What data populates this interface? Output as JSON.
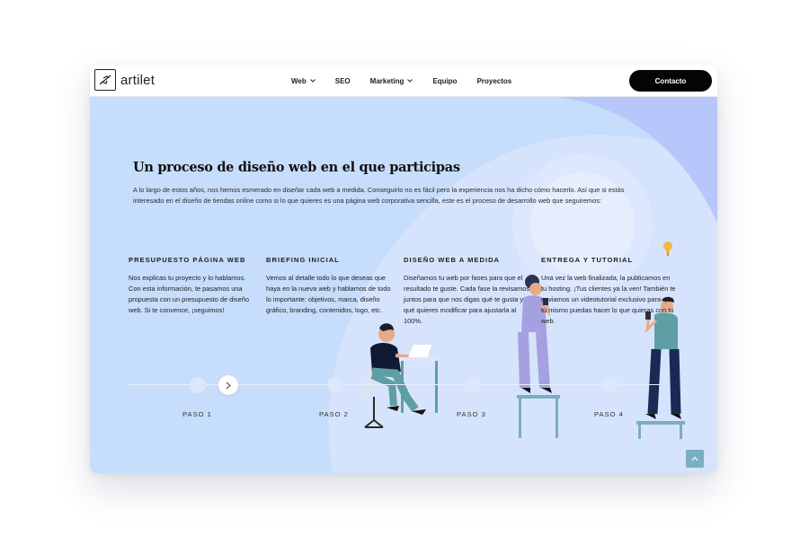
{
  "brand": {
    "name": "artilet",
    "icon": "plane-logo-icon"
  },
  "nav": {
    "items": [
      {
        "label": "Web",
        "has_dropdown": true
      },
      {
        "label": "SEO",
        "has_dropdown": false
      },
      {
        "label": "Marketing",
        "has_dropdown": true
      },
      {
        "label": "Equipo",
        "has_dropdown": false
      },
      {
        "label": "Proyectos",
        "has_dropdown": false
      }
    ],
    "cta_label": "Contacto"
  },
  "section": {
    "title": "Un proceso de diseño web en el que participas",
    "intro": "A lo largo de estos años, nos hemos esmerado en diseñar cada web a medida. Conseguirlo no es fácil pero la experiencia nos ha dicho cómo hacerlo. Así que si estás interesado en el diseño de tiendas online como si lo que quieres es una página web corporativa sencilla, este es el proceso de desarrollo web que seguiremos:"
  },
  "steps": [
    {
      "title": "PRESUPUESTO PÁGINA WEB",
      "text": "Nos explicas tu proyecto y lo hablamos. Con esta información, te pasamos una propuesta con un presupuesto de diseño web. Si te convence, ¡seguimos!",
      "label": "PASO 1"
    },
    {
      "title": "BRIEFING INICIAL",
      "text": "Vemos al detalle todo lo que deseas que haya en la nueva web y hablamos de todo lo importante: objetivos, marca, diseño gráfico, branding, contenidos, logo, etc.",
      "label": "PASO 2"
    },
    {
      "title": "DISEÑO WEB A MEDIDA",
      "text": "Diseñamos tu web por fases para que el resultado te guste. Cada fase la revisamos juntos para que nos digas qué te gusta y qué quieres modificar para ajustarla al 100%.",
      "label": "PASO 3"
    },
    {
      "title": "ENTREGA Y TUTORIAL",
      "text": "Una vez la web finalizada, la publicamos en tu hosting. ¡Tus clientes ya la ven! También te enviamos un videotutorial exclusivo para que tú mismo puedas hacer lo que quieras con tu web.",
      "label": "PASO 4"
    }
  ],
  "colors": {
    "background": "#c6ddfb",
    "cta": "#050505",
    "scroll_button": "#7aaec0"
  },
  "icons": {
    "next": "chevron-right-icon",
    "scroll_top": "arrow-up-icon",
    "dropdown": "chevron-down-icon"
  }
}
